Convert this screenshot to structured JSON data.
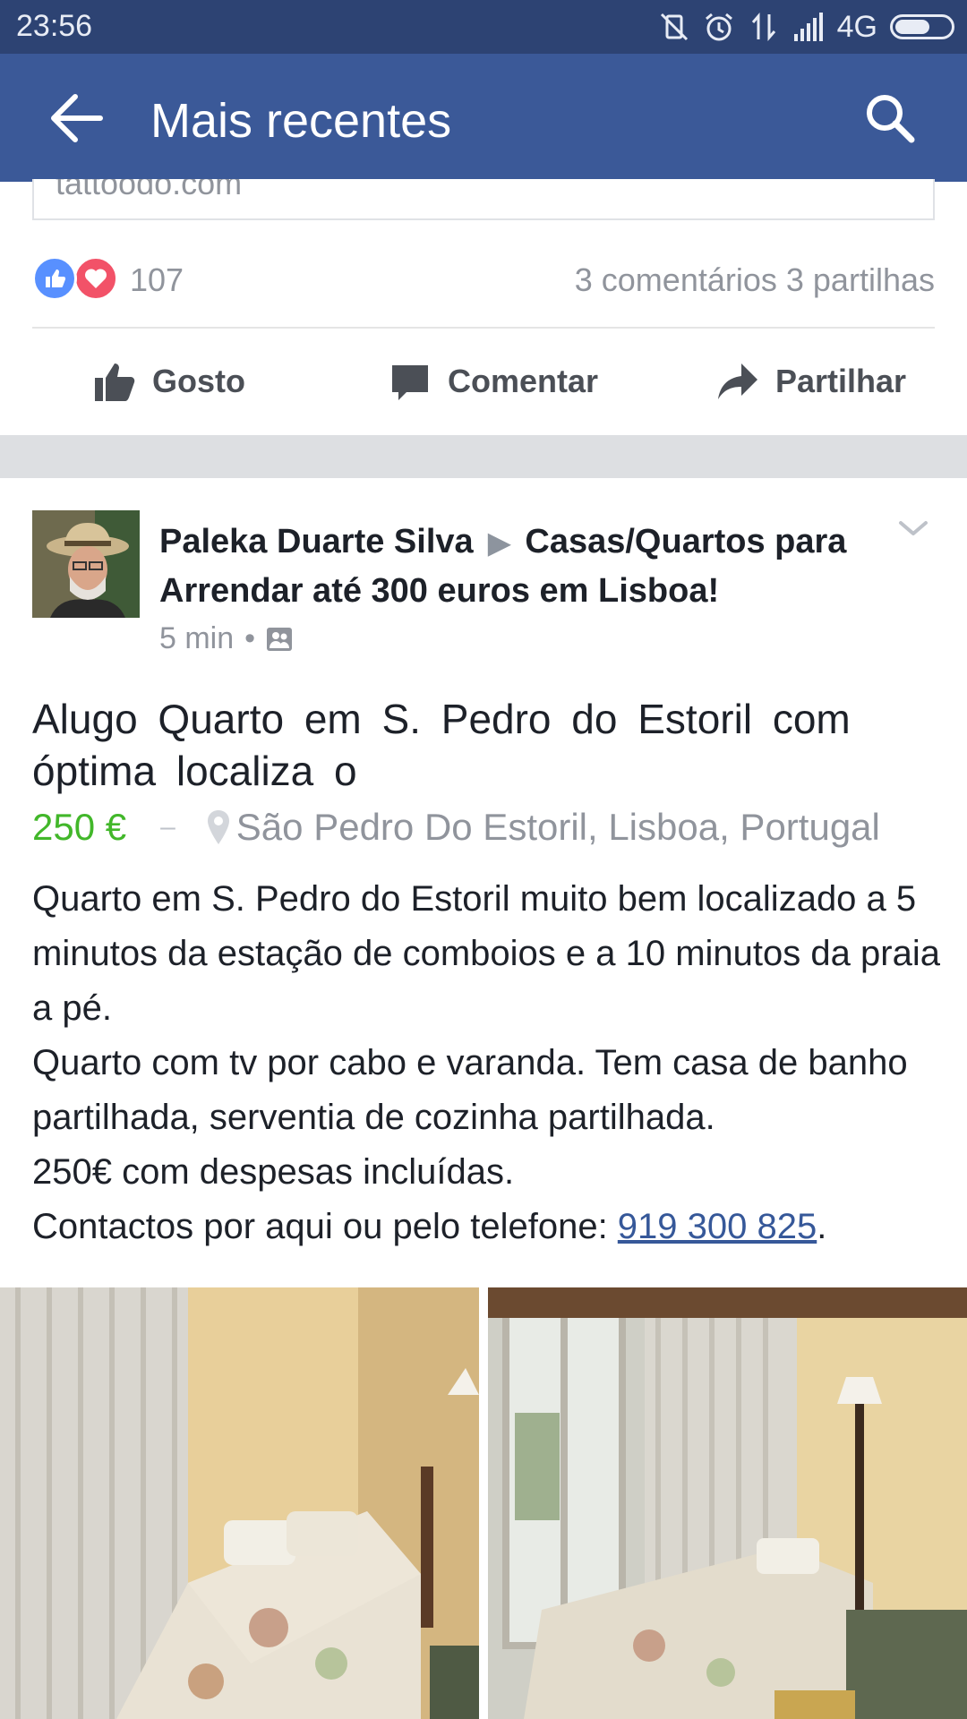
{
  "status_bar": {
    "time": "23:56",
    "network": "4G"
  },
  "app_bar": {
    "title": "Mais recentes"
  },
  "prev_post": {
    "link_domain": "tattoodo.com",
    "reaction_count": "107",
    "comments": "3 comentários",
    "shares": "3 partilhas",
    "actions": {
      "like": "Gosto",
      "comment": "Comentar",
      "share": "Partilhar"
    }
  },
  "post": {
    "author": "Paleka Duarte Silva",
    "arrow": "▶",
    "group": "Casas/Quartos para Arrendar até 300 euros em Lisboa!",
    "time": "5 min",
    "dot": "•",
    "listing": {
      "title": "Alugo Quarto em S. Pedro do Estoril com óptima localiza     o",
      "price": "250 €",
      "separator": "–",
      "location": "São Pedro Do Estoril, Lisboa, Portugal"
    },
    "body": "Quarto em S. Pedro do Estoril muito bem localizado a 5 minutos da estação de comboios e a 10 minutos da praia a pé.\nQuarto com tv por cabo e varanda. Tem casa de banho partilhada, serventia de cozinha partilhada.\n250€  com despesas incluídas.\nContactos por aqui ou pelo telefone: ",
    "phone": "919 300 825",
    "body_end": "."
  },
  "colors": {
    "brand": "#3b5998",
    "price": "#42b72a",
    "link": "#365899"
  }
}
